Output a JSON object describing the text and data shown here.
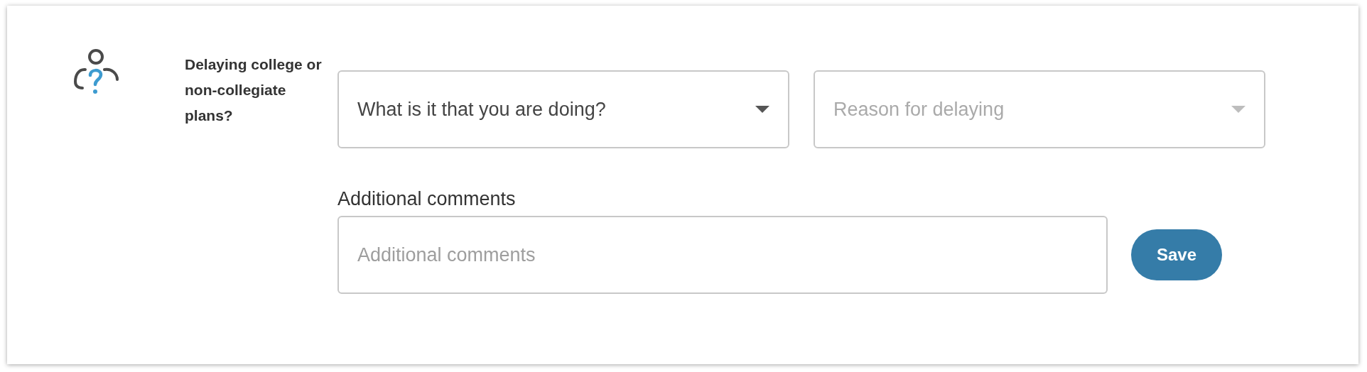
{
  "question": {
    "title": "Delaying college or non-collegiate plans?"
  },
  "selects": [
    {
      "value": "What is it that you are doing?",
      "disabled": false
    },
    {
      "placeholder": "Reason for delaying",
      "disabled": true
    }
  ],
  "comments": {
    "label": "Additional comments",
    "placeholder": "Additional comments"
  },
  "save_button": {
    "label": "Save"
  }
}
